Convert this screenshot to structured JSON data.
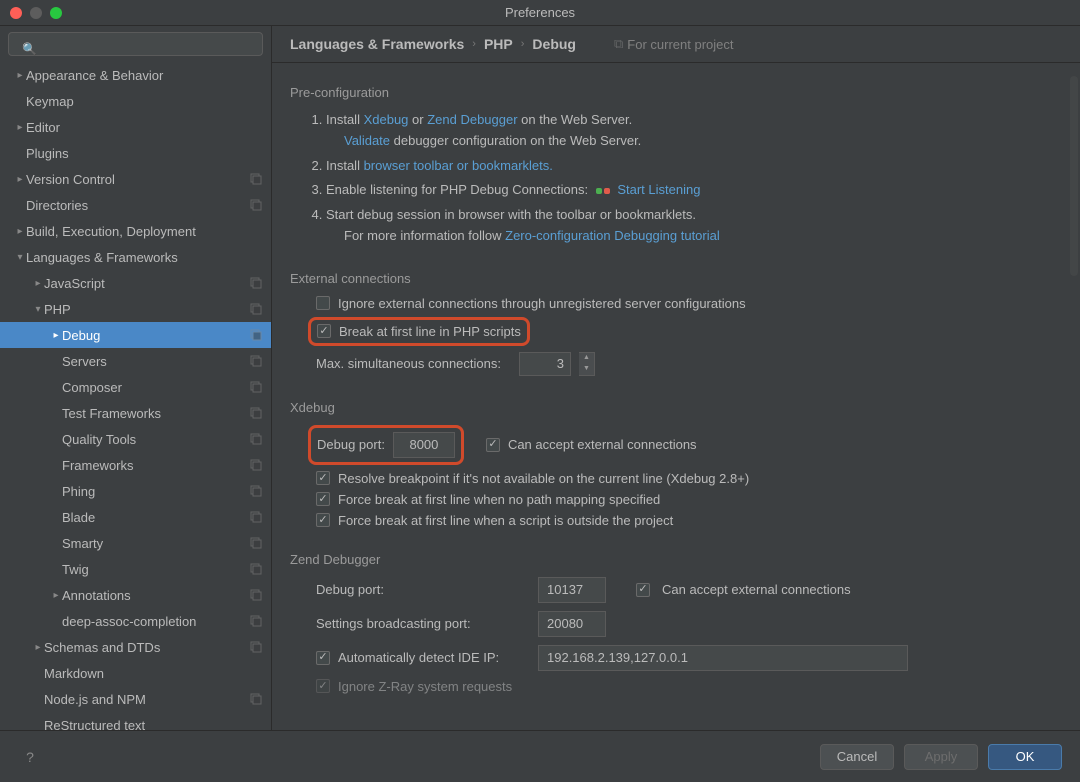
{
  "window": {
    "title": "Preferences"
  },
  "search": {
    "placeholder": ""
  },
  "sidebar": {
    "items": [
      {
        "label": "Appearance & Behavior",
        "indent": 0,
        "state": "collapsed",
        "proj": false
      },
      {
        "label": "Keymap",
        "indent": 0,
        "state": "leaf",
        "proj": false
      },
      {
        "label": "Editor",
        "indent": 0,
        "state": "collapsed",
        "proj": false
      },
      {
        "label": "Plugins",
        "indent": 0,
        "state": "leaf",
        "proj": false
      },
      {
        "label": "Version Control",
        "indent": 0,
        "state": "collapsed",
        "proj": true
      },
      {
        "label": "Directories",
        "indent": 0,
        "state": "leaf",
        "proj": true
      },
      {
        "label": "Build, Execution, Deployment",
        "indent": 0,
        "state": "collapsed",
        "proj": false
      },
      {
        "label": "Languages & Frameworks",
        "indent": 0,
        "state": "expanded",
        "proj": false
      },
      {
        "label": "JavaScript",
        "indent": 1,
        "state": "collapsed",
        "proj": true
      },
      {
        "label": "PHP",
        "indent": 1,
        "state": "expanded",
        "proj": true
      },
      {
        "label": "Debug",
        "indent": 2,
        "state": "collapsed",
        "proj": true,
        "selected": true
      },
      {
        "label": "Servers",
        "indent": 2,
        "state": "leaf",
        "proj": true
      },
      {
        "label": "Composer",
        "indent": 2,
        "state": "leaf",
        "proj": true
      },
      {
        "label": "Test Frameworks",
        "indent": 2,
        "state": "leaf",
        "proj": true
      },
      {
        "label": "Quality Tools",
        "indent": 2,
        "state": "leaf",
        "proj": true
      },
      {
        "label": "Frameworks",
        "indent": 2,
        "state": "leaf",
        "proj": true
      },
      {
        "label": "Phing",
        "indent": 2,
        "state": "leaf",
        "proj": true
      },
      {
        "label": "Blade",
        "indent": 2,
        "state": "leaf",
        "proj": true
      },
      {
        "label": "Smarty",
        "indent": 2,
        "state": "leaf",
        "proj": true
      },
      {
        "label": "Twig",
        "indent": 2,
        "state": "leaf",
        "proj": true
      },
      {
        "label": "Annotations",
        "indent": 2,
        "state": "collapsed",
        "proj": true
      },
      {
        "label": "deep-assoc-completion",
        "indent": 2,
        "state": "leaf",
        "proj": true
      },
      {
        "label": "Schemas and DTDs",
        "indent": 1,
        "state": "collapsed",
        "proj": true
      },
      {
        "label": "Markdown",
        "indent": 1,
        "state": "leaf",
        "proj": false
      },
      {
        "label": "Node.js and NPM",
        "indent": 1,
        "state": "leaf",
        "proj": true
      },
      {
        "label": "ReStructured text",
        "indent": 1,
        "state": "leaf",
        "proj": false
      }
    ]
  },
  "breadcrumb": {
    "a": "Languages & Frameworks",
    "b": "PHP",
    "c": "Debug",
    "note": "For current project"
  },
  "preconfig": {
    "title": "Pre-configuration",
    "s1a": "Install ",
    "s1_xdebug": "Xdebug",
    "s1b": " or ",
    "s1_zend": "Zend Debugger",
    "s1c": " on the Web Server.",
    "s1_validate": "Validate",
    "s1d": " debugger configuration on the Web Server.",
    "s2a": "Install ",
    "s2_link": "browser toolbar or bookmarklets.",
    "s3a": "Enable listening for PHP Debug Connections: ",
    "s3_link": "Start Listening",
    "s4a": "Start debug session in browser with the toolbar or bookmarklets.",
    "s4b": "For more information follow ",
    "s4_link": "Zero-configuration Debugging tutorial"
  },
  "external": {
    "title": "External connections",
    "ignore": {
      "checked": false,
      "label": "Ignore external connections through unregistered server configurations"
    },
    "break_first": {
      "checked": true,
      "label": "Break at first line in PHP scripts"
    },
    "max_conn_label": "Max. simultaneous connections:",
    "max_conn_value": "3"
  },
  "xdebug": {
    "title": "Xdebug",
    "port_label": "Debug port:",
    "port_value": "8000",
    "accept": {
      "checked": true,
      "label": "Can accept external connections"
    },
    "resolve": {
      "checked": true,
      "label": "Resolve breakpoint if it's not available on the current line (Xdebug 2.8+)"
    },
    "force_nopath": {
      "checked": true,
      "label": "Force break at first line when no path mapping specified"
    },
    "force_outside": {
      "checked": true,
      "label": "Force break at first line when a script is outside the project"
    }
  },
  "zend": {
    "title": "Zend Debugger",
    "port_label": "Debug port:",
    "port_value": "10137",
    "accept": {
      "checked": true,
      "label": "Can accept external connections"
    },
    "bcast_label": "Settings broadcasting port:",
    "bcast_value": "20080",
    "auto_ip": {
      "checked": true,
      "label": "Automatically detect IDE IP:"
    },
    "ip_value": "192.168.2.139,127.0.0.1",
    "ignore_zray": {
      "checked": true,
      "label": "Ignore Z-Ray system requests"
    }
  },
  "footer": {
    "cancel": "Cancel",
    "apply": "Apply",
    "ok": "OK"
  }
}
